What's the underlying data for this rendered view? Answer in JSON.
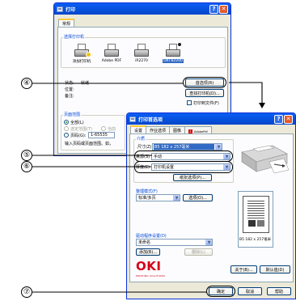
{
  "print_dialog": {
    "title": "打印",
    "tabs": [
      "常规"
    ],
    "select_printer_label": "选择打印机",
    "printers": [
      {
        "name": "添加打印机",
        "icon": "add-printer-icon"
      },
      {
        "name": "Adobe PDF",
        "icon": "printer-icon"
      },
      {
        "name": "iR2270",
        "icon": "printer-icon"
      },
      {
        "name": "OKI B2200",
        "icon": "default-printer-icon",
        "selected": true
      }
    ],
    "status_label": "状态:",
    "status_value": "就绪",
    "location_label": "位置:",
    "comment_label": "备注:",
    "preferences_button": "首选项(R)",
    "find_printer_button": "查找打印机(D)...",
    "print_to_file_label": "打印到文件(F)",
    "page_range_label": "页面范围",
    "all_label": "全部(L)",
    "selection_label": "选定范围(T)",
    "current_page_label": "当前",
    "pages_label": "页码(G):",
    "pages_value": "1-65535",
    "pages_hint": "输入页码或页面范围。如，"
  },
  "prefs_dialog": {
    "title": "打印首选项",
    "tabs": [
      "设置",
      "作业选项",
      "图像",
      "AdobePdf"
    ],
    "paper_group_label": "介质",
    "size_label": "尺寸(Z)",
    "size_value": "B5 182 x 257毫米",
    "source_label": "来源(S)",
    "source_value": "手动",
    "weight_label": "厚度(E)",
    "weight_value": "打印机设置",
    "paper_options_button": "纸张选项(P)...",
    "finishing_label": "整理模式(F)",
    "finishing_value": "标准/多页",
    "options_button": "选项(O)...",
    "driver_settings_label": "驱动程序设置(D)",
    "driver_settings_value": "未命名",
    "save_button": "添加(B)...",
    "delete_button": "删除(L)",
    "preview_caption": "B5 182 x 257毫米",
    "about_button": "关于(B)...",
    "default_button": "默认值(D)",
    "ok_button": "确定",
    "cancel_button": "取消",
    "help_button": "帮助",
    "logo_text": "OKI",
    "logo_subtext": "PRINTING SOLUTIONS"
  },
  "callouts": {
    "c4": "④",
    "c5": "⑤",
    "c6": "⑥",
    "c7": "⑦"
  },
  "colors": {
    "title_bar": "#0a5ef5",
    "selection": "#316ac5",
    "oki_red": "#d4001a",
    "group_label": "#0046d5"
  }
}
